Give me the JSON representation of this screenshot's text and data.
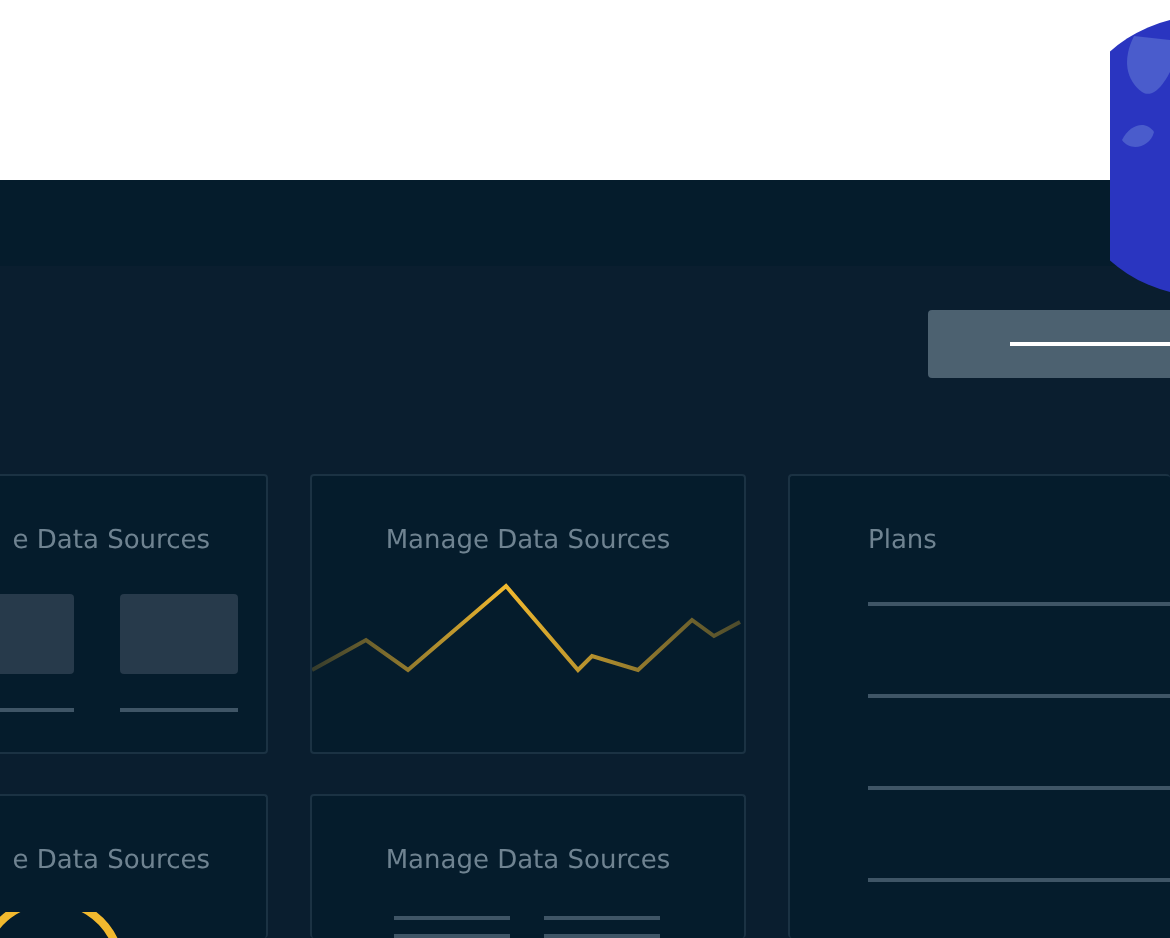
{
  "cards": [
    {
      "kind": "tiles",
      "title": "e Data Sources"
    },
    {
      "kind": "sparkline",
      "title": "Manage Data Sources"
    },
    {
      "kind": "gauge",
      "title": "e Data Sources"
    },
    {
      "kind": "lines",
      "title": "Manage Data Sources"
    }
  ],
  "plans": {
    "title": "Plans"
  }
}
